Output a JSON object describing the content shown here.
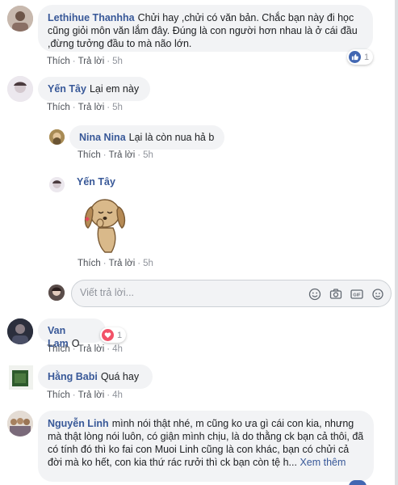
{
  "comments": [
    {
      "author": "Lethihue Thanhha",
      "text": "Chửi hay ,chửi có văn bản. Chắc bạn này đi học cũng giỏi môn văn lắm đây. Đúng là con người hơn nhau là ở cái đầu ,đừng tưởng đầu to mà não lớn.",
      "like": "Thích",
      "reply": "Trả lời",
      "time": "5h",
      "reaction_count": "1",
      "reaction_type": "like"
    },
    {
      "author": "Yến Tây",
      "text": "Lại em này",
      "like": "Thích",
      "reply": "Trả lời",
      "time": "5h"
    }
  ],
  "replies": [
    {
      "author": "Nina Nina",
      "text": "Lại là còn nua hả b",
      "like": "Thích",
      "reply": "Trả lời",
      "time": "5h"
    },
    {
      "author": "Yến Tây",
      "sticker": "dog-kiss-sticker",
      "like": "Thích",
      "reply": "Trả lời",
      "time": "5h"
    }
  ],
  "reply_box": {
    "placeholder": "Viết trả lời..."
  },
  "comments_after": [
    {
      "author": "Van Lam",
      "text": "O",
      "like": "Thích",
      "reply": "Trả lời",
      "time": "4h",
      "reaction_count": "1",
      "reaction_type": "love"
    },
    {
      "author": "Hằng Babi",
      "text": "Quá hay",
      "like": "Thích",
      "reply": "Trả lời",
      "time": "4h"
    },
    {
      "author": "Nguyễn Linh",
      "text": "mình nói thật nhé, m cũng ko ưa gì cái con kia, nhưng mà thật lòng nói luôn, có giận mình chịu, là do thằng ck bạn cả thôi, đã có tính đó thì ko fai con Muoi Linh cũng là con khác, bạn có chửi cả đời mà ko hết, con kia thứ rác rưởi thì ck bạn còn tệ h...",
      "more": "Xem thêm"
    }
  ],
  "colors": {
    "link": "#385898",
    "bubble": "#f2f3f5",
    "meta": "#90949c",
    "like_blue": "#4267b2",
    "love_red": "#f25268"
  },
  "icons": [
    "emoji-icon",
    "camera-icon",
    "gif-icon",
    "sticker-icon",
    "like-reaction-icon",
    "love-reaction-icon"
  ]
}
